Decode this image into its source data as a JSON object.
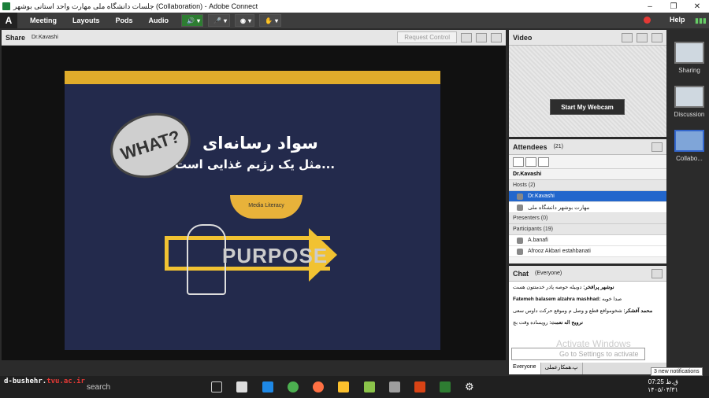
{
  "window": {
    "title": "جلسات دانشگاه ملی مهارت واحد استانی بوشهر (Collaboration) - Adobe Connect"
  },
  "menubar": {
    "logo": "Adobe",
    "items": [
      "Meeting",
      "Layouts",
      "Pods",
      "Audio"
    ],
    "help": "Help"
  },
  "share": {
    "title": "Share",
    "presenter": "Dr.Kavashi",
    "request_control": "Request Control"
  },
  "slide": {
    "bubble": "WHAT?",
    "line1": "سواد رسانه‌ای",
    "line2": "مثل یک رژیم غذایی است...",
    "bowl_label": "Media Literacy",
    "arrow_text": "PURPOSE"
  },
  "video": {
    "title": "Video",
    "start_webcam": "Start My Webcam"
  },
  "attendees": {
    "title": "Attendees",
    "count": "(21)",
    "filter_name": "Dr.Kavashi",
    "hosts_label": "Hosts (2)",
    "hosts": [
      "Dr.Kavashi",
      "مهارت بوشهر دانشگاه ملی"
    ],
    "presenters_label": "Presenters (0)",
    "participants_label": "Participants (19)",
    "participants": [
      "A.banafi",
      "Afrooz Akbari estahbanati"
    ]
  },
  "chat": {
    "title": "Chat",
    "scope": "(Everyone)",
    "messages": [
      {
        "user": "نوشهر پرافخر:",
        "text": "دوبیله حوصه پادر خدمتتون هست"
      },
      {
        "user": "Fatemeh balasem alzahra mashhad:",
        "text": "صدا خوبه"
      },
      {
        "user": "محمد آفشکر:",
        "text": "شخوموافع قطع و وصل م وموقع حرکت داوس سعی"
      },
      {
        "user": "نرویح اله نعمت:",
        "text": "رویساده وقت بچ"
      }
    ],
    "input_placeholder": "Go to Settings to activate",
    "tabs": [
      "Everyone",
      "پ.همکارعملی"
    ]
  },
  "watermark": {
    "line1": "Activate Windows"
  },
  "layouts": [
    {
      "label": "Sharing"
    },
    {
      "label": "Discussion"
    },
    {
      "label": "Collabo..."
    }
  ],
  "taskbar": {
    "url_prefix": "d-bushehr.",
    "url_suffix": "tvu.ac.ir",
    "search": "search",
    "time": "07:25 ق.ظ",
    "date": "۱۴۰۵/۰۴/۳۱",
    "lang": "FA",
    "notifications": "3 new notifications"
  },
  "colors": {
    "accent": "#e0ac2b",
    "slide_bg": "#232a4c",
    "selected": "#2266cc"
  }
}
